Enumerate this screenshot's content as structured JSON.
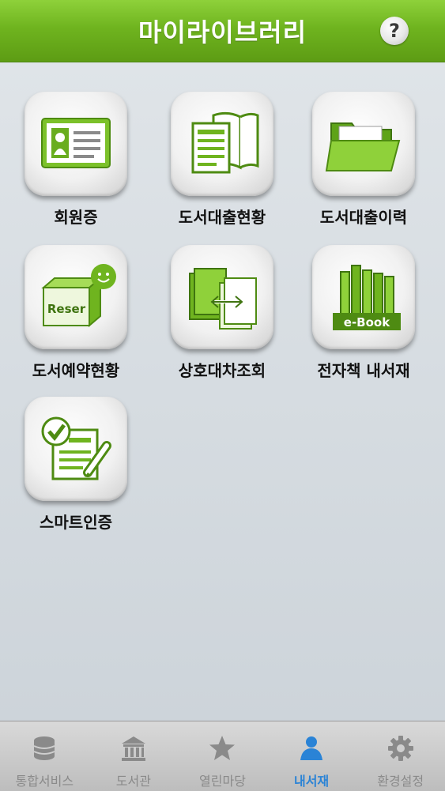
{
  "header": {
    "title": "마이라이브러리",
    "help_label": "?"
  },
  "menu": [
    {
      "label": "회원증",
      "icon": "member-card-icon"
    },
    {
      "label": "도서대출현황",
      "icon": "book-loan-status-icon"
    },
    {
      "label": "도서대출이력",
      "icon": "loan-history-folder-icon"
    },
    {
      "label": "도서예약현황",
      "icon": "reservation-box-icon",
      "icon_text": "Reser"
    },
    {
      "label": "상호대차조회",
      "icon": "interlibrary-loan-icon"
    },
    {
      "label": "전자책 내서재",
      "icon": "ebook-shelf-icon",
      "icon_text": "e-Book"
    },
    {
      "label": "스마트인증",
      "icon": "smart-auth-icon"
    }
  ],
  "tabs": [
    {
      "label": "통합서비스",
      "icon": "database-icon",
      "active": false
    },
    {
      "label": "도서관",
      "icon": "library-building-icon",
      "active": false
    },
    {
      "label": "열린마당",
      "icon": "star-icon",
      "active": false
    },
    {
      "label": "내서재",
      "icon": "person-icon",
      "active": true
    },
    {
      "label": "환경설정",
      "icon": "gear-icon",
      "active": false
    }
  ],
  "colors": {
    "accent": "#6fb41f",
    "tab_active": "#2a83d6",
    "tab_inactive": "#8a8a8a"
  }
}
